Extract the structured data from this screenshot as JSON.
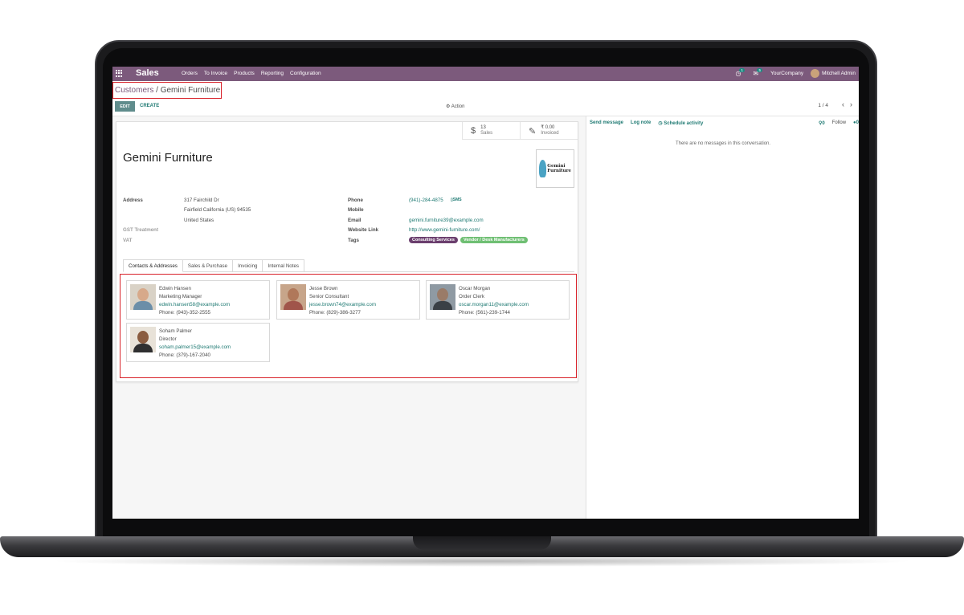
{
  "navbar": {
    "app_name": "Sales",
    "menu": [
      "Orders",
      "To Invoice",
      "Products",
      "Reporting",
      "Configuration"
    ],
    "activity_count": "1",
    "message_count": "5",
    "company": "YourCompany",
    "user": "Mitchell Admin"
  },
  "breadcrumb": {
    "parent": "Customers",
    "separator": "/",
    "current": "Gemini Furniture"
  },
  "toolbar": {
    "edit": "EDIT",
    "create": "CREATE",
    "action": "Action",
    "pager": "1 / 4"
  },
  "stats": [
    {
      "value": "13",
      "label": "Sales",
      "icon": "dollar-icon"
    },
    {
      "value": "₹ 0.00",
      "label": "Invoiced",
      "icon": "edit-icon"
    }
  ],
  "record": {
    "name": "Gemini Furniture",
    "logo_text_1": "Gemini",
    "logo_text_2": "Furniture",
    "address_label": "Address",
    "street": "317 Fairchild Dr",
    "city_line": "Fairfield  California (US)  94535",
    "country": "United States",
    "gst_label": "GST Treatment",
    "vat_label": "VAT",
    "phone_label": "Phone",
    "phone": "(941)-284-4875",
    "sms": "SMS",
    "mobile_label": "Mobile",
    "email_label": "Email",
    "email": "gemini.furniture39@example.com",
    "website_label": "Website Link",
    "website": "http://www.gemini-furniture.com/",
    "tags_label": "Tags",
    "tags": [
      {
        "label": "Consulting Services",
        "color": "#6b3f6e"
      },
      {
        "label": "Vendor / Desk Manufacturers",
        "color": "#6fbf73"
      }
    ]
  },
  "tabs": [
    "Contacts & Addresses",
    "Sales & Purchase",
    "Invoicing",
    "Internal Notes"
  ],
  "contacts": [
    {
      "name": "Edwin Hansen",
      "title": "Marketing Manager",
      "email": "edwin.hansen58@example.com",
      "phone": "Phone: (943)-352-2555"
    },
    {
      "name": "Jesse Brown",
      "title": "Senior Consultant",
      "email": "jesse.brown74@example.com",
      "phone": "Phone: (829)-386-3277"
    },
    {
      "name": "Oscar Morgan",
      "title": "Order Clerk",
      "email": "oscar.morgan11@example.com",
      "phone": "Phone: (561)-239-1744"
    },
    {
      "name": "Soham Palmer",
      "title": "Director",
      "email": "soham.palmer15@example.com",
      "phone": "Phone: (379)-167-2040"
    }
  ],
  "chatter": {
    "send_message": "Send message",
    "log_note": "Log note",
    "schedule_activity": "Schedule activity",
    "attachments": "0",
    "follow": "Follow",
    "followers": "0",
    "empty": "There are no messages in this conversation."
  }
}
